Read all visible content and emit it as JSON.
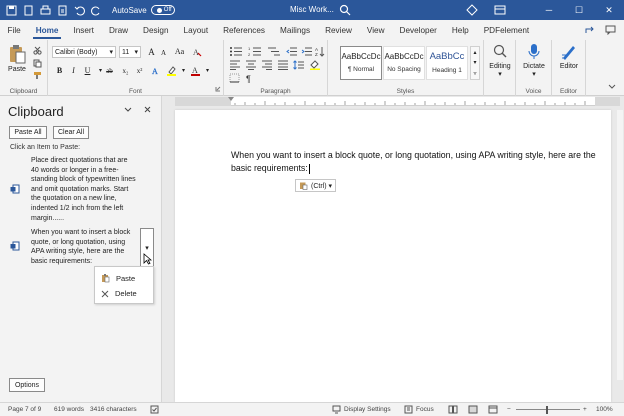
{
  "titlebar": {
    "autosave_label": "AutoSave",
    "autosave_state": "Off",
    "doc_title": "Misc Work...",
    "minimize": "─",
    "maximize": "☐",
    "close": "✕"
  },
  "menu": {
    "tabs": [
      "File",
      "Home",
      "Insert",
      "Draw",
      "Design",
      "Layout",
      "References",
      "Mailings",
      "Review",
      "View",
      "Developer",
      "Help",
      "PDFelement"
    ],
    "active": "Home"
  },
  "ribbon": {
    "clipboard": {
      "paste_label": "Paste",
      "group_label": "Clipboard"
    },
    "font": {
      "font_name": "Calibri (Body)",
      "font_size": "11",
      "group_label": "Font",
      "grow": "A",
      "shrink": "A",
      "case": "Aa"
    },
    "paragraph": {
      "group_label": "Paragraph"
    },
    "styles": {
      "group_label": "Styles",
      "items": [
        {
          "sample": "AaBbCcDc",
          "name": "¶ Normal"
        },
        {
          "sample": "AaBbCcDc",
          "name": "No Spacing"
        },
        {
          "sample": "AaBbCc",
          "name": "Heading 1"
        }
      ]
    },
    "editing": {
      "label": "Editing"
    },
    "voice": {
      "dictate_label": "Dictate",
      "group_label": "Voice"
    },
    "editor": {
      "label": "Editor",
      "group_label": "Editor"
    }
  },
  "pane": {
    "title": "Clipboard",
    "paste_all": "Paste All",
    "clear_all": "Clear All",
    "hint": "Click an Item to Paste:",
    "items": [
      "Place direct quotations that are 40 words or longer in a free-standing block of typewritten lines and omit quotation marks. Start the quotation on a new line, indented 1/2 inch from the left margin......",
      "When you want to insert a block quote, or long quotation, using APA writing style, here are the basic requirements:"
    ],
    "context_menu": {
      "paste": "Paste",
      "delete": "Delete"
    },
    "options": "Options"
  },
  "document": {
    "text": "When you want to insert a block quote, or long quotation, using APA writing style, here are the basic requirements:",
    "paste_options": "(Ctrl) ▾"
  },
  "status": {
    "page": "Page 7 of 9",
    "words": "619 words",
    "characters": "3416 characters",
    "display_settings": "Display Settings",
    "focus": "Focus",
    "zoom": "100%"
  },
  "colors": {
    "accent": "#2b579a",
    "highlight": "#ffff00",
    "font_color": "#c00000"
  }
}
